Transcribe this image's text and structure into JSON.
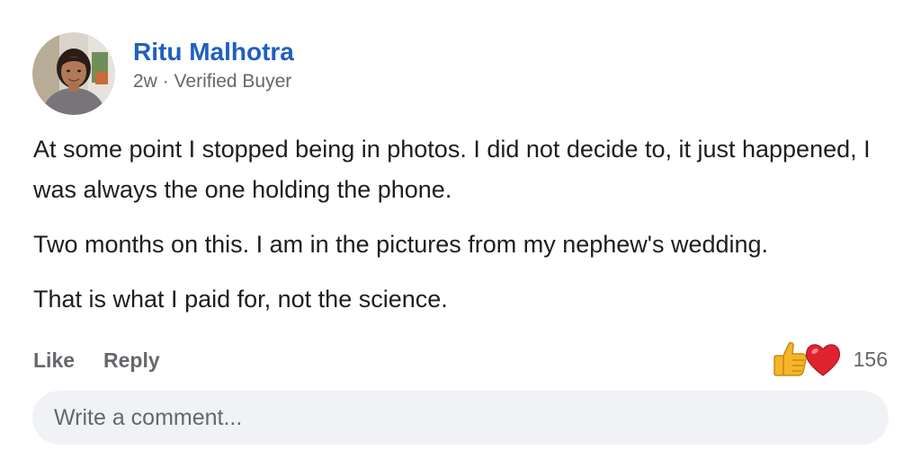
{
  "post": {
    "author": {
      "name": "Ritu Malhotra",
      "avatar_icon": "user-avatar-photo"
    },
    "meta": {
      "age": "2w",
      "separator": "·",
      "badge": "Verified Buyer"
    },
    "paragraphs": [
      "At some point I stopped being in photos. I did not decide to, it just happened, I was always the one holding the phone.",
      "Two months on this. I am in the pictures from my nephew's wedding.",
      "That is what I paid for, not the science."
    ],
    "actions": {
      "like_label": "Like",
      "reply_label": "Reply"
    },
    "reactions": {
      "icons": [
        "thumbs-up-icon",
        "heart-icon"
      ],
      "count": "156"
    },
    "comment": {
      "placeholder": "Write a comment...",
      "value": ""
    }
  },
  "colors": {
    "author_name": "#1f5fbf",
    "meta_text": "#65676b",
    "comment_bg": "#f0f2f5",
    "heart": "#e0242f",
    "thumb": "#f5b528"
  }
}
